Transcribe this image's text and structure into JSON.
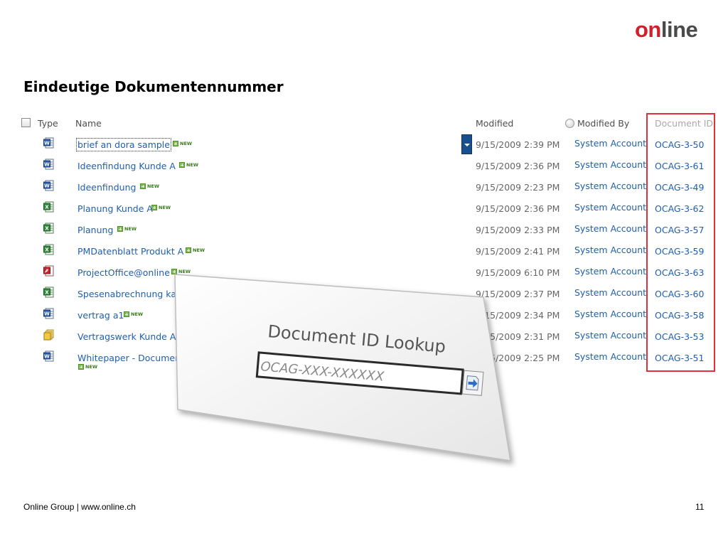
{
  "logo": {
    "part1": "on",
    "part2": "line"
  },
  "page_title": "Eindeutige Dokumentennummer",
  "list": {
    "headers": {
      "type": "Type",
      "name": "Name",
      "modified": "Modified",
      "modified_by": "Modified By",
      "document_id": "Document ID"
    },
    "new_label": "NEW",
    "rows": [
      {
        "icon": "word-doc-icon",
        "name": "brief an dora sample",
        "modified": "9/15/2009 2:39 PM",
        "modified_by": "System Account",
        "document_id": "OCAG-3-50"
      },
      {
        "icon": "word-doc-icon",
        "name": "Ideenfindung Kunde A",
        "modified": "9/15/2009 2:36 PM",
        "modified_by": "System Account",
        "document_id": "OCAG-3-61"
      },
      {
        "icon": "word-doc-icon",
        "name": "Ideenfindung",
        "modified": "9/15/2009 2:23 PM",
        "modified_by": "System Account",
        "document_id": "OCAG-3-49"
      },
      {
        "icon": "excel-doc-icon",
        "name": "Planung Kunde A",
        "modified": "9/15/2009 2:36 PM",
        "modified_by": "System Account",
        "document_id": "OCAG-3-62"
      },
      {
        "icon": "excel-doc-icon",
        "name": "Planung",
        "modified": "9/15/2009 2:33 PM",
        "modified_by": "System Account",
        "document_id": "OCAG-3-57"
      },
      {
        "icon": "excel-doc-icon",
        "name": "PMDatenblatt Produkt A",
        "modified": "9/15/2009 2:41 PM",
        "modified_by": "System Account",
        "document_id": "OCAG-3-59"
      },
      {
        "icon": "pdf-doc-icon",
        "name": "ProjectOffice@online",
        "modified": "9/15/2009 6:10 PM",
        "modified_by": "System Account",
        "document_id": "OCAG-3-63"
      },
      {
        "icon": "excel-doc-icon",
        "name": "Spesenabrechnung ka",
        "modified": "9/15/2009 2:37 PM",
        "modified_by": "System Account",
        "document_id": "OCAG-3-60"
      },
      {
        "icon": "word-doc-icon",
        "name": "vertrag a1",
        "modified": "9/15/2009 2:34 PM",
        "modified_by": "System Account",
        "document_id": "OCAG-3-58"
      },
      {
        "icon": "document-set-icon",
        "name": "Vertragswerk Kunde A",
        "modified": "9/15/2009 2:31 PM",
        "modified_by": "System Account",
        "document_id": "OCAG-3-53"
      },
      {
        "icon": "word-doc-icon",
        "name": "Whitepaper - Documen",
        "modified": "9/15/2009 2:25 PM",
        "modified_by": "System Account",
        "document_id": "OCAG-3-51"
      }
    ]
  },
  "lookup": {
    "title": "Document ID Lookup",
    "placeholder": "OCAG-XXX-XXXXXX",
    "go_icon": "go-arrow-icon"
  },
  "footer": {
    "left": "Online Group | www.online.ch",
    "page_number": "11"
  },
  "colors": {
    "brand_red": "#d0202a",
    "link_blue": "#1f5fae",
    "highlight": "#e0303a"
  }
}
